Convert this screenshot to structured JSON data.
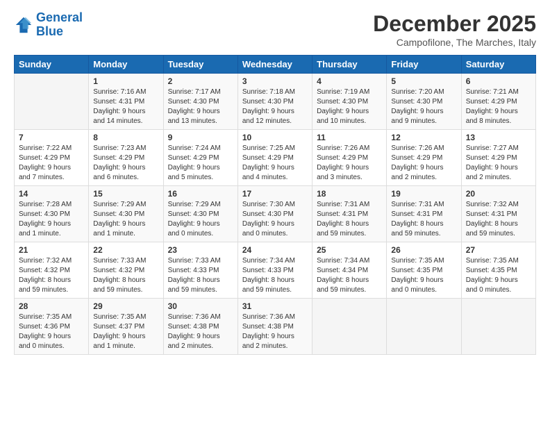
{
  "logo": {
    "line1": "General",
    "line2": "Blue"
  },
  "title": "December 2025",
  "location": "Campofilone, The Marches, Italy",
  "weekdays": [
    "Sunday",
    "Monday",
    "Tuesday",
    "Wednesday",
    "Thursday",
    "Friday",
    "Saturday"
  ],
  "weeks": [
    [
      {
        "day": "",
        "sunrise": "",
        "sunset": "",
        "daylight": ""
      },
      {
        "day": "1",
        "sunrise": "Sunrise: 7:16 AM",
        "sunset": "Sunset: 4:31 PM",
        "daylight": "Daylight: 9 hours and 14 minutes."
      },
      {
        "day": "2",
        "sunrise": "Sunrise: 7:17 AM",
        "sunset": "Sunset: 4:30 PM",
        "daylight": "Daylight: 9 hours and 13 minutes."
      },
      {
        "day": "3",
        "sunrise": "Sunrise: 7:18 AM",
        "sunset": "Sunset: 4:30 PM",
        "daylight": "Daylight: 9 hours and 12 minutes."
      },
      {
        "day": "4",
        "sunrise": "Sunrise: 7:19 AM",
        "sunset": "Sunset: 4:30 PM",
        "daylight": "Daylight: 9 hours and 10 minutes."
      },
      {
        "day": "5",
        "sunrise": "Sunrise: 7:20 AM",
        "sunset": "Sunset: 4:30 PM",
        "daylight": "Daylight: 9 hours and 9 minutes."
      },
      {
        "day": "6",
        "sunrise": "Sunrise: 7:21 AM",
        "sunset": "Sunset: 4:29 PM",
        "daylight": "Daylight: 9 hours and 8 minutes."
      }
    ],
    [
      {
        "day": "7",
        "sunrise": "Sunrise: 7:22 AM",
        "sunset": "Sunset: 4:29 PM",
        "daylight": "Daylight: 9 hours and 7 minutes."
      },
      {
        "day": "8",
        "sunrise": "Sunrise: 7:23 AM",
        "sunset": "Sunset: 4:29 PM",
        "daylight": "Daylight: 9 hours and 6 minutes."
      },
      {
        "day": "9",
        "sunrise": "Sunrise: 7:24 AM",
        "sunset": "Sunset: 4:29 PM",
        "daylight": "Daylight: 9 hours and 5 minutes."
      },
      {
        "day": "10",
        "sunrise": "Sunrise: 7:25 AM",
        "sunset": "Sunset: 4:29 PM",
        "daylight": "Daylight: 9 hours and 4 minutes."
      },
      {
        "day": "11",
        "sunrise": "Sunrise: 7:26 AM",
        "sunset": "Sunset: 4:29 PM",
        "daylight": "Daylight: 9 hours and 3 minutes."
      },
      {
        "day": "12",
        "sunrise": "Sunrise: 7:26 AM",
        "sunset": "Sunset: 4:29 PM",
        "daylight": "Daylight: 9 hours and 2 minutes."
      },
      {
        "day": "13",
        "sunrise": "Sunrise: 7:27 AM",
        "sunset": "Sunset: 4:29 PM",
        "daylight": "Daylight: 9 hours and 2 minutes."
      }
    ],
    [
      {
        "day": "14",
        "sunrise": "Sunrise: 7:28 AM",
        "sunset": "Sunset: 4:30 PM",
        "daylight": "Daylight: 9 hours and 1 minute."
      },
      {
        "day": "15",
        "sunrise": "Sunrise: 7:29 AM",
        "sunset": "Sunset: 4:30 PM",
        "daylight": "Daylight: 9 hours and 1 minute."
      },
      {
        "day": "16",
        "sunrise": "Sunrise: 7:29 AM",
        "sunset": "Sunset: 4:30 PM",
        "daylight": "Daylight: 9 hours and 0 minutes."
      },
      {
        "day": "17",
        "sunrise": "Sunrise: 7:30 AM",
        "sunset": "Sunset: 4:30 PM",
        "daylight": "Daylight: 9 hours and 0 minutes."
      },
      {
        "day": "18",
        "sunrise": "Sunrise: 7:31 AM",
        "sunset": "Sunset: 4:31 PM",
        "daylight": "Daylight: 8 hours and 59 minutes."
      },
      {
        "day": "19",
        "sunrise": "Sunrise: 7:31 AM",
        "sunset": "Sunset: 4:31 PM",
        "daylight": "Daylight: 8 hours and 59 minutes."
      },
      {
        "day": "20",
        "sunrise": "Sunrise: 7:32 AM",
        "sunset": "Sunset: 4:31 PM",
        "daylight": "Daylight: 8 hours and 59 minutes."
      }
    ],
    [
      {
        "day": "21",
        "sunrise": "Sunrise: 7:32 AM",
        "sunset": "Sunset: 4:32 PM",
        "daylight": "Daylight: 8 hours and 59 minutes."
      },
      {
        "day": "22",
        "sunrise": "Sunrise: 7:33 AM",
        "sunset": "Sunset: 4:32 PM",
        "daylight": "Daylight: 8 hours and 59 minutes."
      },
      {
        "day": "23",
        "sunrise": "Sunrise: 7:33 AM",
        "sunset": "Sunset: 4:33 PM",
        "daylight": "Daylight: 8 hours and 59 minutes."
      },
      {
        "day": "24",
        "sunrise": "Sunrise: 7:34 AM",
        "sunset": "Sunset: 4:33 PM",
        "daylight": "Daylight: 8 hours and 59 minutes."
      },
      {
        "day": "25",
        "sunrise": "Sunrise: 7:34 AM",
        "sunset": "Sunset: 4:34 PM",
        "daylight": "Daylight: 8 hours and 59 minutes."
      },
      {
        "day": "26",
        "sunrise": "Sunrise: 7:35 AM",
        "sunset": "Sunset: 4:35 PM",
        "daylight": "Daylight: 9 hours and 0 minutes."
      },
      {
        "day": "27",
        "sunrise": "Sunrise: 7:35 AM",
        "sunset": "Sunset: 4:35 PM",
        "daylight": "Daylight: 9 hours and 0 minutes."
      }
    ],
    [
      {
        "day": "28",
        "sunrise": "Sunrise: 7:35 AM",
        "sunset": "Sunset: 4:36 PM",
        "daylight": "Daylight: 9 hours and 0 minutes."
      },
      {
        "day": "29",
        "sunrise": "Sunrise: 7:35 AM",
        "sunset": "Sunset: 4:37 PM",
        "daylight": "Daylight: 9 hours and 1 minute."
      },
      {
        "day": "30",
        "sunrise": "Sunrise: 7:36 AM",
        "sunset": "Sunset: 4:38 PM",
        "daylight": "Daylight: 9 hours and 2 minutes."
      },
      {
        "day": "31",
        "sunrise": "Sunrise: 7:36 AM",
        "sunset": "Sunset: 4:38 PM",
        "daylight": "Daylight: 9 hours and 2 minutes."
      },
      {
        "day": "",
        "sunrise": "",
        "sunset": "",
        "daylight": ""
      },
      {
        "day": "",
        "sunrise": "",
        "sunset": "",
        "daylight": ""
      },
      {
        "day": "",
        "sunrise": "",
        "sunset": "",
        "daylight": ""
      }
    ]
  ]
}
